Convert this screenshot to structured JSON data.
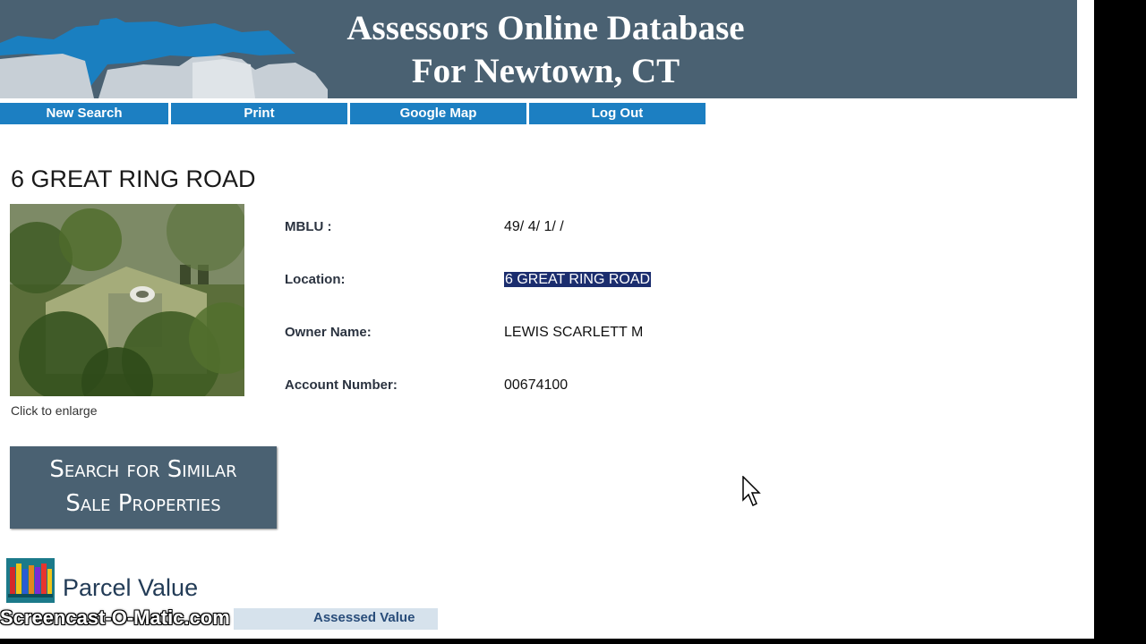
{
  "header": {
    "title_line1": "Assessors Online Database",
    "title_line2": "For Newtown, CT"
  },
  "nav": {
    "items": [
      "New Search",
      "Print",
      "Google Map",
      "Log Out"
    ]
  },
  "property": {
    "address_heading": "6 GREAT RING ROAD",
    "photo_caption": "Click to enlarge",
    "fields": [
      {
        "label": "MBLU :",
        "value": "49/ 4/ 1/ /"
      },
      {
        "label": "Location:",
        "value": "6 GREAT RING ROAD",
        "selected": true
      },
      {
        "label": "Owner Name:",
        "value": "LEWIS SCARLETT M"
      },
      {
        "label": "Account Number:",
        "value": "00674100"
      }
    ]
  },
  "similar_button": {
    "line1": "Search for Similar",
    "line2": "Sale Properties"
  },
  "parcel": {
    "title": "Parcel Value",
    "assessed_header": "Assessed Value"
  },
  "watermark": "Screencast-O-Matic.com",
  "colors": {
    "header_bg": "#4a6172",
    "nav_bg": "#1c7fc2",
    "selection_bg": "#1b2d6e",
    "skyline": "#1a7fc0"
  }
}
